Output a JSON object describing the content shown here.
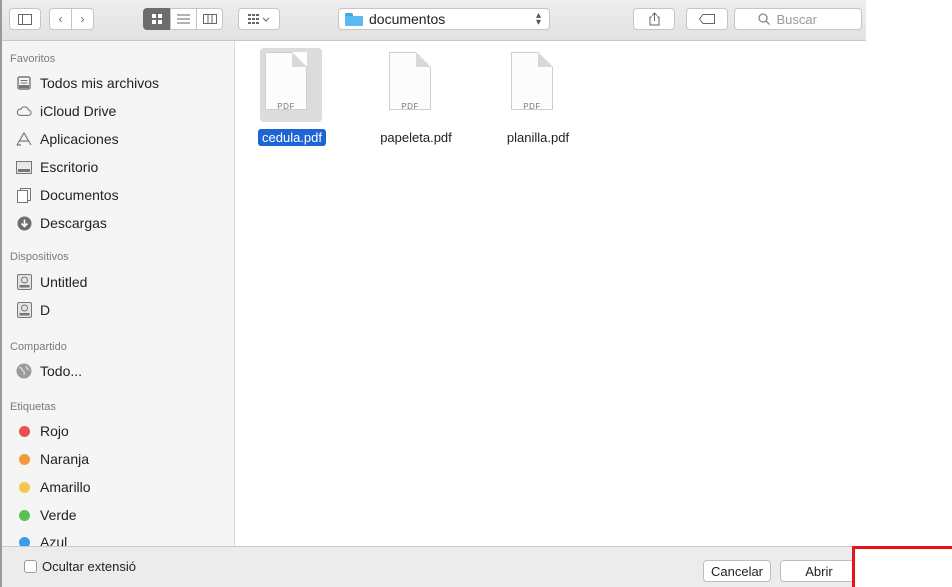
{
  "toolbar": {
    "path_folder": "documentos",
    "search_placeholder": "Buscar"
  },
  "sidebar": {
    "favoritos_header": "Favoritos",
    "favoritos": [
      "Todos mis archivos",
      "iCloud Drive",
      "Aplicaciones",
      "Escritorio",
      "Documentos",
      "Descargas"
    ],
    "dispositivos_header": "Dispositivos",
    "dispositivos": [
      "Untitled",
      "D"
    ],
    "compartido_header": "Compartido",
    "compartido": [
      "Todo..."
    ],
    "etiquetas_header": "Etiquetas",
    "etiquetas": [
      {
        "label": "Rojo",
        "color": "#e9504c"
      },
      {
        "label": "Naranja",
        "color": "#f59a3c"
      },
      {
        "label": "Amarillo",
        "color": "#f6c84a"
      },
      {
        "label": "Verde",
        "color": "#57c152"
      },
      {
        "label": "Azul",
        "color": "#3a9bf0"
      }
    ]
  },
  "files": [
    {
      "name": "cedula.pdf",
      "type_tag": "PDF",
      "selected": true
    },
    {
      "name": "papeleta.pdf",
      "type_tag": "PDF",
      "selected": false
    },
    {
      "name": "planilla.pdf",
      "type_tag": "PDF",
      "selected": false
    }
  ],
  "bottom": {
    "hide_extension_label": "Ocultar extensió",
    "cancel_label": "Cancelar",
    "open_label": "Abrir"
  },
  "highlight_color": "#e5141b"
}
